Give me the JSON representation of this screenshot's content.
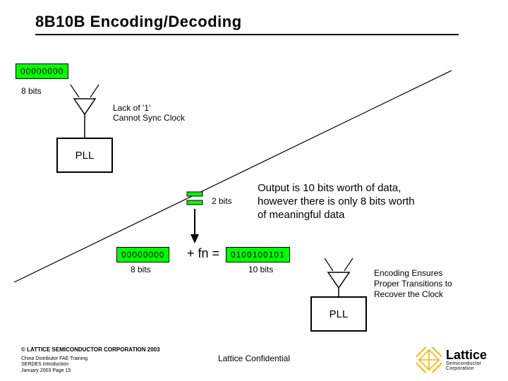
{
  "title": "8B10B Encoding/Decoding",
  "input_bits": "00000000",
  "input_label": "8 bits",
  "warn_line1": "Lack of '1'",
  "warn_line2": "Cannot Sync Clock",
  "pll_label": "PLL",
  "two_bits_label": "2 bits",
  "explain_line1": "Output is 10 bits worth of data,",
  "explain_line2": "however there is only 8 bits worth",
  "explain_line3": "of meaningful data",
  "input_bits2": "00000000",
  "input_label2": "8 bits",
  "fn_text": "+ fn =",
  "output_bits": "0100100101",
  "output_label": "10 bits",
  "result_line1": "Encoding Ensures",
  "result_line2": "Proper Transitions to",
  "result_line3": "Recover the Clock",
  "pll_label2": "PLL",
  "footer_copy": "© LATTICE SEMICONDUCTOR CORPORATION 2003",
  "footer_l1": "China Distributor FAE Training",
  "footer_l2": "SERDES Introduction",
  "footer_l3": "January 2003  Page 15",
  "footer_center": "Lattice Confidential",
  "logo_name": "Lattice",
  "logo_sub1": "Semiconductor",
  "logo_sub2": "Corporation",
  "colors": {
    "data_box": "#01fe01"
  }
}
